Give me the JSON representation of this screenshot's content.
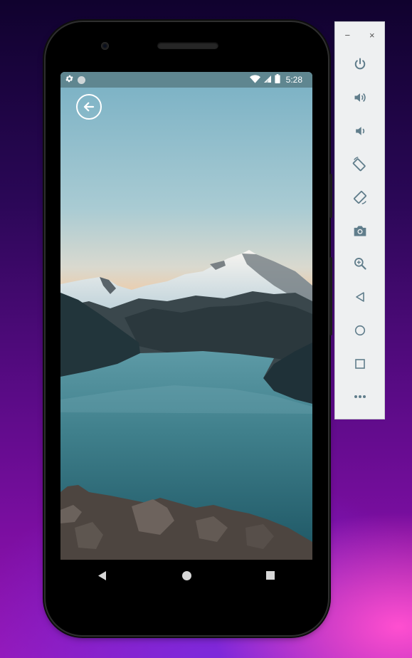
{
  "status_bar": {
    "time": "5:28"
  },
  "panel": {
    "minimize_label": "−",
    "close_label": "×",
    "tools": [
      {
        "name": "power-icon"
      },
      {
        "name": "volume-up-icon"
      },
      {
        "name": "volume-down-icon"
      },
      {
        "name": "rotate-left-icon"
      },
      {
        "name": "rotate-right-icon"
      },
      {
        "name": "camera-icon"
      },
      {
        "name": "zoom-icon"
      },
      {
        "name": "back-icon"
      },
      {
        "name": "home-icon"
      },
      {
        "name": "overview-icon"
      },
      {
        "name": "more-icon"
      }
    ]
  },
  "colors": {
    "accent": "#5f7e8a",
    "statusbar": "#5f8690"
  }
}
